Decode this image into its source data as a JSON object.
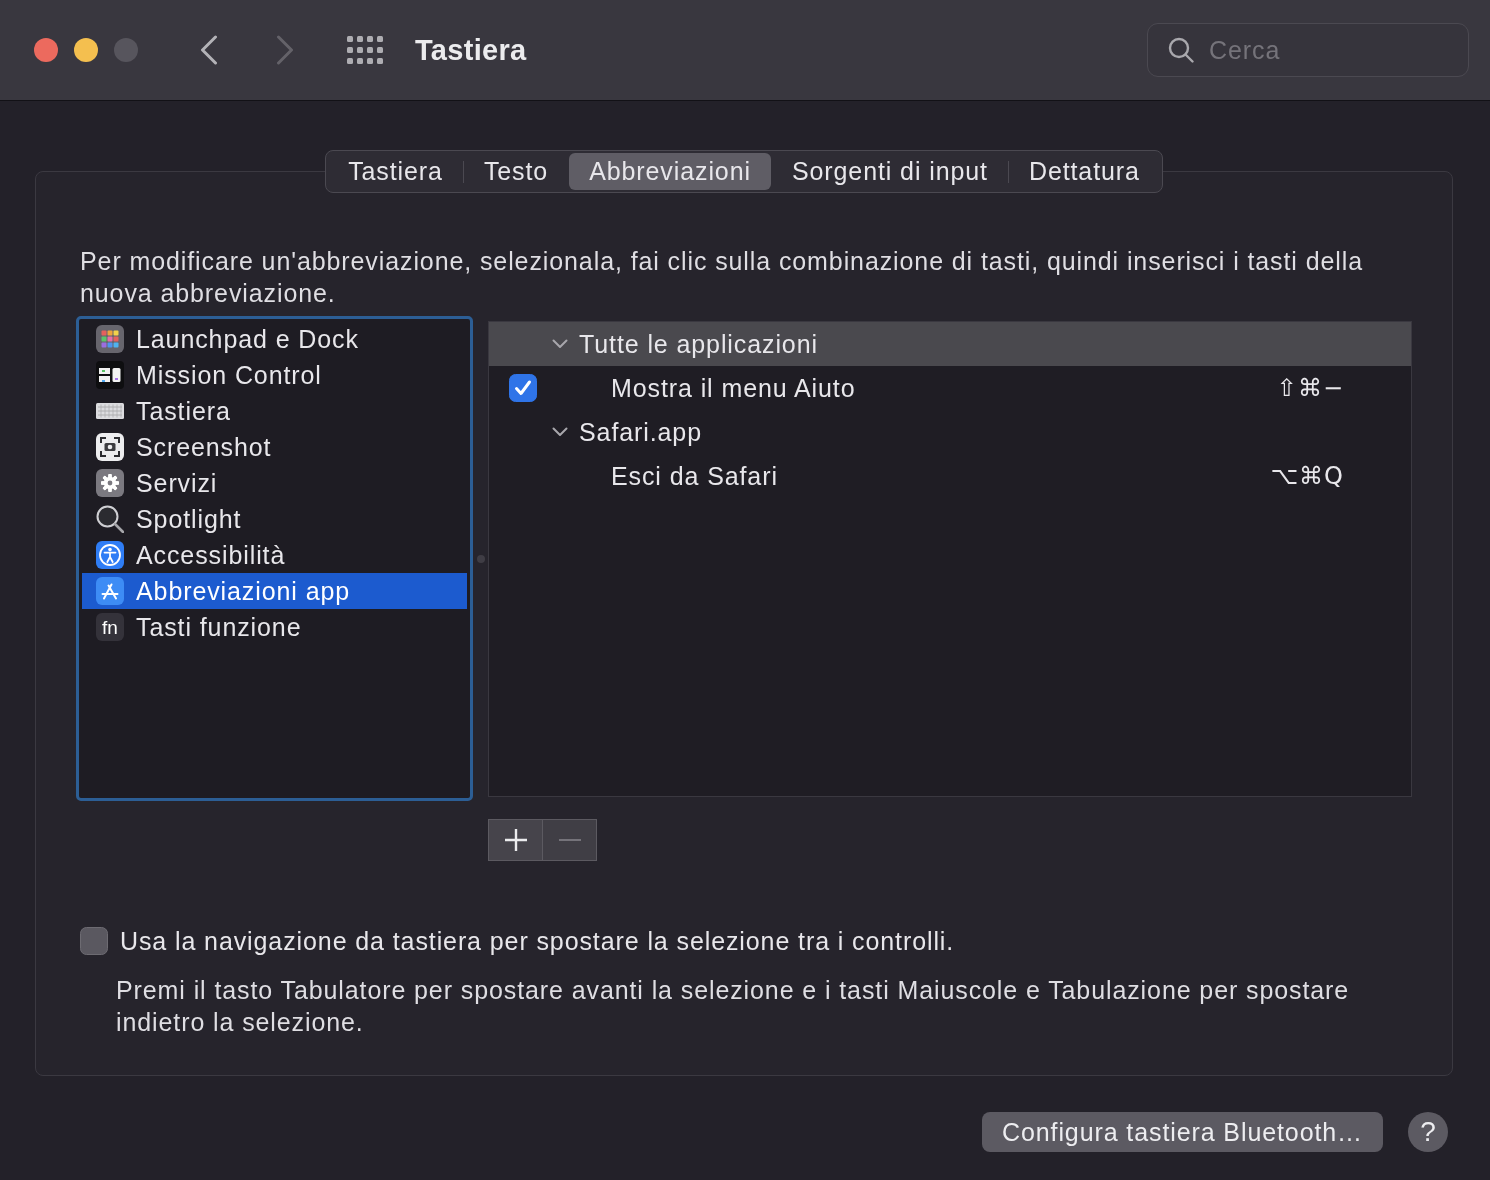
{
  "window": {
    "title": "Tastiera"
  },
  "navigation": [
    {
      "kind": "back",
      "disabled": false
    },
    {
      "kind": "forward",
      "disabled": true
    }
  ],
  "search": {
    "placeholder": "Cerca"
  },
  "tabs": [
    {
      "label": "Tastiera",
      "selected": false
    },
    {
      "label": "Testo",
      "selected": false
    },
    {
      "label": "Abbreviazioni",
      "selected": true
    },
    {
      "label": "Sorgenti di input",
      "selected": false
    },
    {
      "label": "Dettatura",
      "selected": false
    }
  ],
  "description": "Per modificare un'abbreviazione, selezionala, fai clic sulla combinazione di tasti, quindi inserisci i tasti della nuova abbreviazione.",
  "categories": {
    "focused": true,
    "items": [
      {
        "kind": "launchpad",
        "label": "Launchpad e Dock",
        "selected": false
      },
      {
        "kind": "missioncontrol",
        "label": "Mission Control",
        "selected": false
      },
      {
        "kind": "keyboard",
        "label": "Tastiera",
        "selected": false
      },
      {
        "kind": "screenshot",
        "label": "Screenshot",
        "selected": false
      },
      {
        "kind": "services",
        "label": "Servizi",
        "selected": false
      },
      {
        "kind": "spotlight",
        "label": "Spotlight",
        "selected": false
      },
      {
        "kind": "accessibility",
        "label": "Accessibilità",
        "selected": false
      },
      {
        "kind": "appshortcuts",
        "label": "Abbreviazioni app",
        "selected": true
      },
      {
        "kind": "functionkeys",
        "label": "Tasti funzione",
        "icon_text": "fn",
        "selected": false
      }
    ]
  },
  "shortcuts": [
    {
      "label": "Tutte le applicazioni",
      "expanded": true,
      "selected": true,
      "children": [
        {
          "kind": "checkbox",
          "label": "Mostra il menu Aiuto",
          "checked": true,
          "keys": "⇧⌘−",
          "selected": false
        }
      ]
    },
    {
      "label": "Safari.app",
      "expanded": true,
      "selected": false,
      "children": [
        {
          "kind": "plain",
          "label": "Esci da Safari",
          "keys": "⌥⌘Q",
          "selected": false
        }
      ]
    }
  ],
  "list_buttons": [
    {
      "kind": "add",
      "disabled": false
    },
    {
      "kind": "remove",
      "disabled": true
    }
  ],
  "keyboard_navigation": {
    "label": "Usa la navigazione da tastiera per spostare la selezione tra i controlli.",
    "checked": false,
    "note": "Premi il tasto Tabulatore per spostare avanti la selezione e i tasti Maiuscole e Tabulazione per spostare indietro la selezione."
  },
  "footer": {
    "button": "Configura tastiera Bluetooth…",
    "help": "?"
  }
}
